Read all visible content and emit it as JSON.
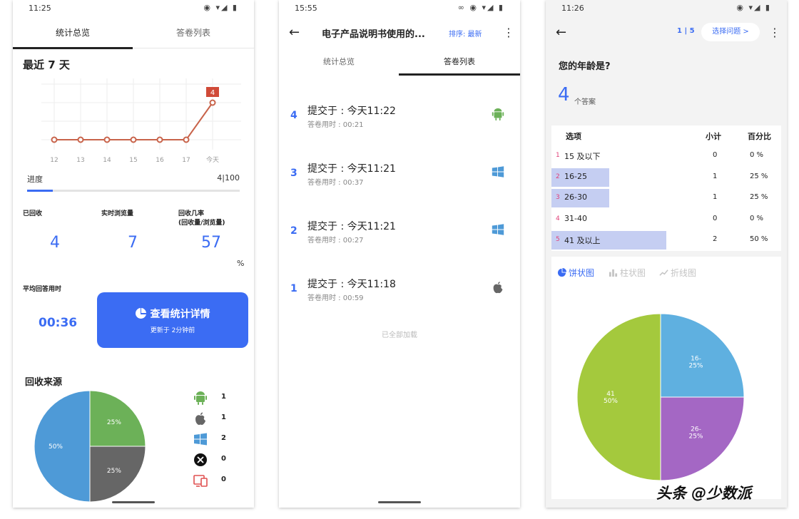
{
  "screen1": {
    "status_time": "11:25",
    "tabs": [
      "统计总览",
      "答卷列表"
    ],
    "section_title": "最近 7 天",
    "chart_data": {
      "type": "line",
      "categories": [
        "12",
        "13",
        "14",
        "15",
        "16",
        "17",
        "今天"
      ],
      "values": [
        0,
        0,
        0,
        0,
        0,
        0,
        4
      ],
      "data_label": "4",
      "ylim": [
        0,
        4
      ],
      "grid": true,
      "color": "#c8634a"
    },
    "progress": {
      "label": "进度",
      "value_text": "4|100",
      "fraction": 0.04
    },
    "stats": [
      {
        "label": "已回收",
        "value": "4"
      },
      {
        "label": "实时浏览量",
        "value": "7"
      },
      {
        "label": "回收几率\n(回收量/浏览量)",
        "value": "57"
      }
    ],
    "percent_unit": "%",
    "avg_label": "平均回答用时",
    "avg_value": "00:36",
    "detail_button": {
      "label": "查看统计详情",
      "sub": "更新于 2分钟前"
    },
    "source_title": "回收来源",
    "source_pie": {
      "type": "pie",
      "slices": [
        {
          "label": "50%",
          "value": 50,
          "color": "#4e9ad7"
        },
        {
          "label": "25%",
          "value": 25,
          "color": "#6cb158"
        },
        {
          "label": "25%",
          "value": 25,
          "color": "#666666"
        }
      ]
    },
    "sources": [
      {
        "icon": "android-icon",
        "count": "1",
        "color": "#6cb158"
      },
      {
        "icon": "apple-icon",
        "count": "1",
        "color": "#666666"
      },
      {
        "icon": "windows-icon",
        "count": "2",
        "color": "#4e9ad7"
      },
      {
        "icon": "x-icon",
        "count": "0",
        "color": "#111111"
      },
      {
        "icon": "devices-icon",
        "count": "0",
        "color": "#e05050"
      }
    ]
  },
  "screen2": {
    "status_time": "15:55",
    "title": "电子产品说明书使用的...",
    "sort_label": "排序: 最新",
    "tabs": [
      "统计总览",
      "答卷列表"
    ],
    "responses": [
      {
        "num": "4",
        "title": "提交于 : 今天11:22",
        "duration": "答卷用时 : 00:21",
        "icon": "android-icon"
      },
      {
        "num": "3",
        "title": "提交于 : 今天11:21",
        "duration": "答卷用时 : 00:37",
        "icon": "windows-icon"
      },
      {
        "num": "2",
        "title": "提交于 : 今天11:21",
        "duration": "答卷用时 : 00:27",
        "icon": "windows-icon"
      },
      {
        "num": "1",
        "title": "提交于 : 今天11:18",
        "duration": "答卷用时 : 00:59",
        "icon": "apple-icon"
      }
    ],
    "all_loaded": "已全部加载"
  },
  "screen3": {
    "status_time": "11:26",
    "page_indicator": "1 | 5",
    "select_question": "选择问题 >",
    "question": "您的年龄是?",
    "answer_count": "4",
    "answer_count_label": "个答案",
    "table": {
      "headers": [
        "选项",
        "小计",
        "百分比"
      ],
      "rows": [
        {
          "idx": "1",
          "option": "15 及以下",
          "count": "0",
          "percent": "0 %",
          "fraction": 0
        },
        {
          "idx": "2",
          "option": "16-25",
          "count": "1",
          "percent": "25 %",
          "fraction": 0.25
        },
        {
          "idx": "3",
          "option": "26-30",
          "count": "1",
          "percent": "25 %",
          "fraction": 0.25
        },
        {
          "idx": "4",
          "option": "31-40",
          "count": "0",
          "percent": "0 %",
          "fraction": 0
        },
        {
          "idx": "5",
          "option": "41 及以上",
          "count": "2",
          "percent": "50 %",
          "fraction": 0.5
        }
      ]
    },
    "chart_tabs": [
      "饼状图",
      "柱状图",
      "折线图"
    ],
    "pie_chart": {
      "type": "pie",
      "slices": [
        {
          "label": "16-\n25%",
          "value": 25,
          "color": "#5fb0e0"
        },
        {
          "label": "26-\n25%",
          "value": 25,
          "color": "#a467c4"
        },
        {
          "label": "41\n50%",
          "value": 50,
          "color": "#a4c93d"
        }
      ]
    }
  },
  "watermark": "头条 @少数派"
}
